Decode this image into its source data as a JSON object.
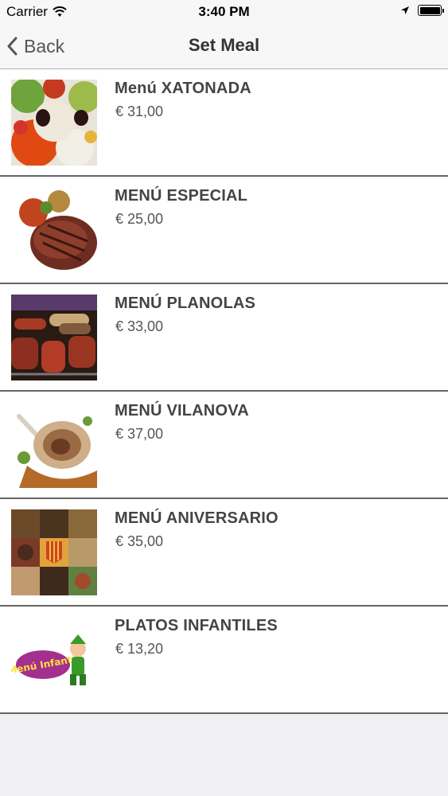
{
  "status": {
    "carrier": "Carrier",
    "time": "3:40 PM"
  },
  "nav": {
    "back_label": "Back",
    "title": "Set Meal"
  },
  "items": [
    {
      "name": "Menú XATONADA",
      "price": "€ 31,00"
    },
    {
      "name": "MENÚ ESPECIAL",
      "price": "€ 25,00"
    },
    {
      "name": "MENÚ PLANOLAS",
      "price": "€ 33,00"
    },
    {
      "name": "MENÚ VILANOVA",
      "price": "€ 37,00"
    },
    {
      "name": "MENÚ ANIVERSARIO",
      "price": "€ 35,00"
    },
    {
      "name": "PLATOS INFANTILES",
      "price": "€ 13,20"
    }
  ],
  "badge_text": "Menú Infantil"
}
